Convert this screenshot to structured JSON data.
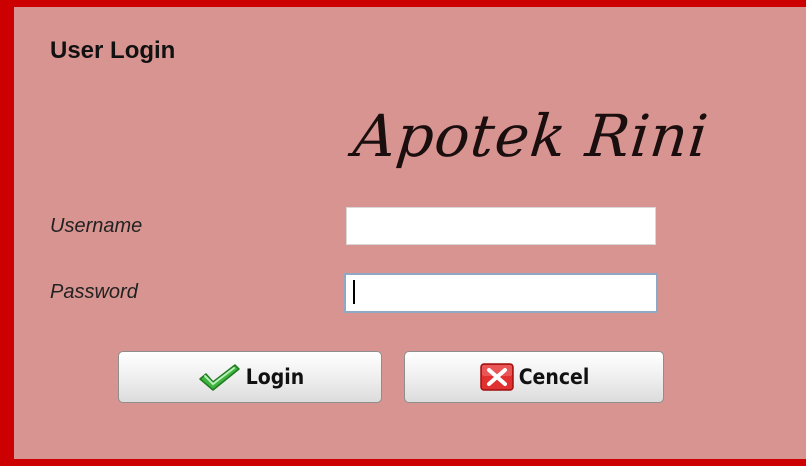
{
  "window": {
    "title": "User Login"
  },
  "brand": {
    "name": "Apotek Rini"
  },
  "form": {
    "username_label": "Username",
    "username_value": "",
    "password_label": "Password",
    "password_value": ""
  },
  "buttons": {
    "login_label": "Login",
    "login_icon": "checkmark-icon",
    "cancel_label": "Cencel",
    "cancel_icon": "close-x-icon"
  },
  "colors": {
    "background": "#d89490",
    "border": "#cc0000",
    "check_green": "#3fb33f",
    "cancel_red": "#e03030"
  }
}
